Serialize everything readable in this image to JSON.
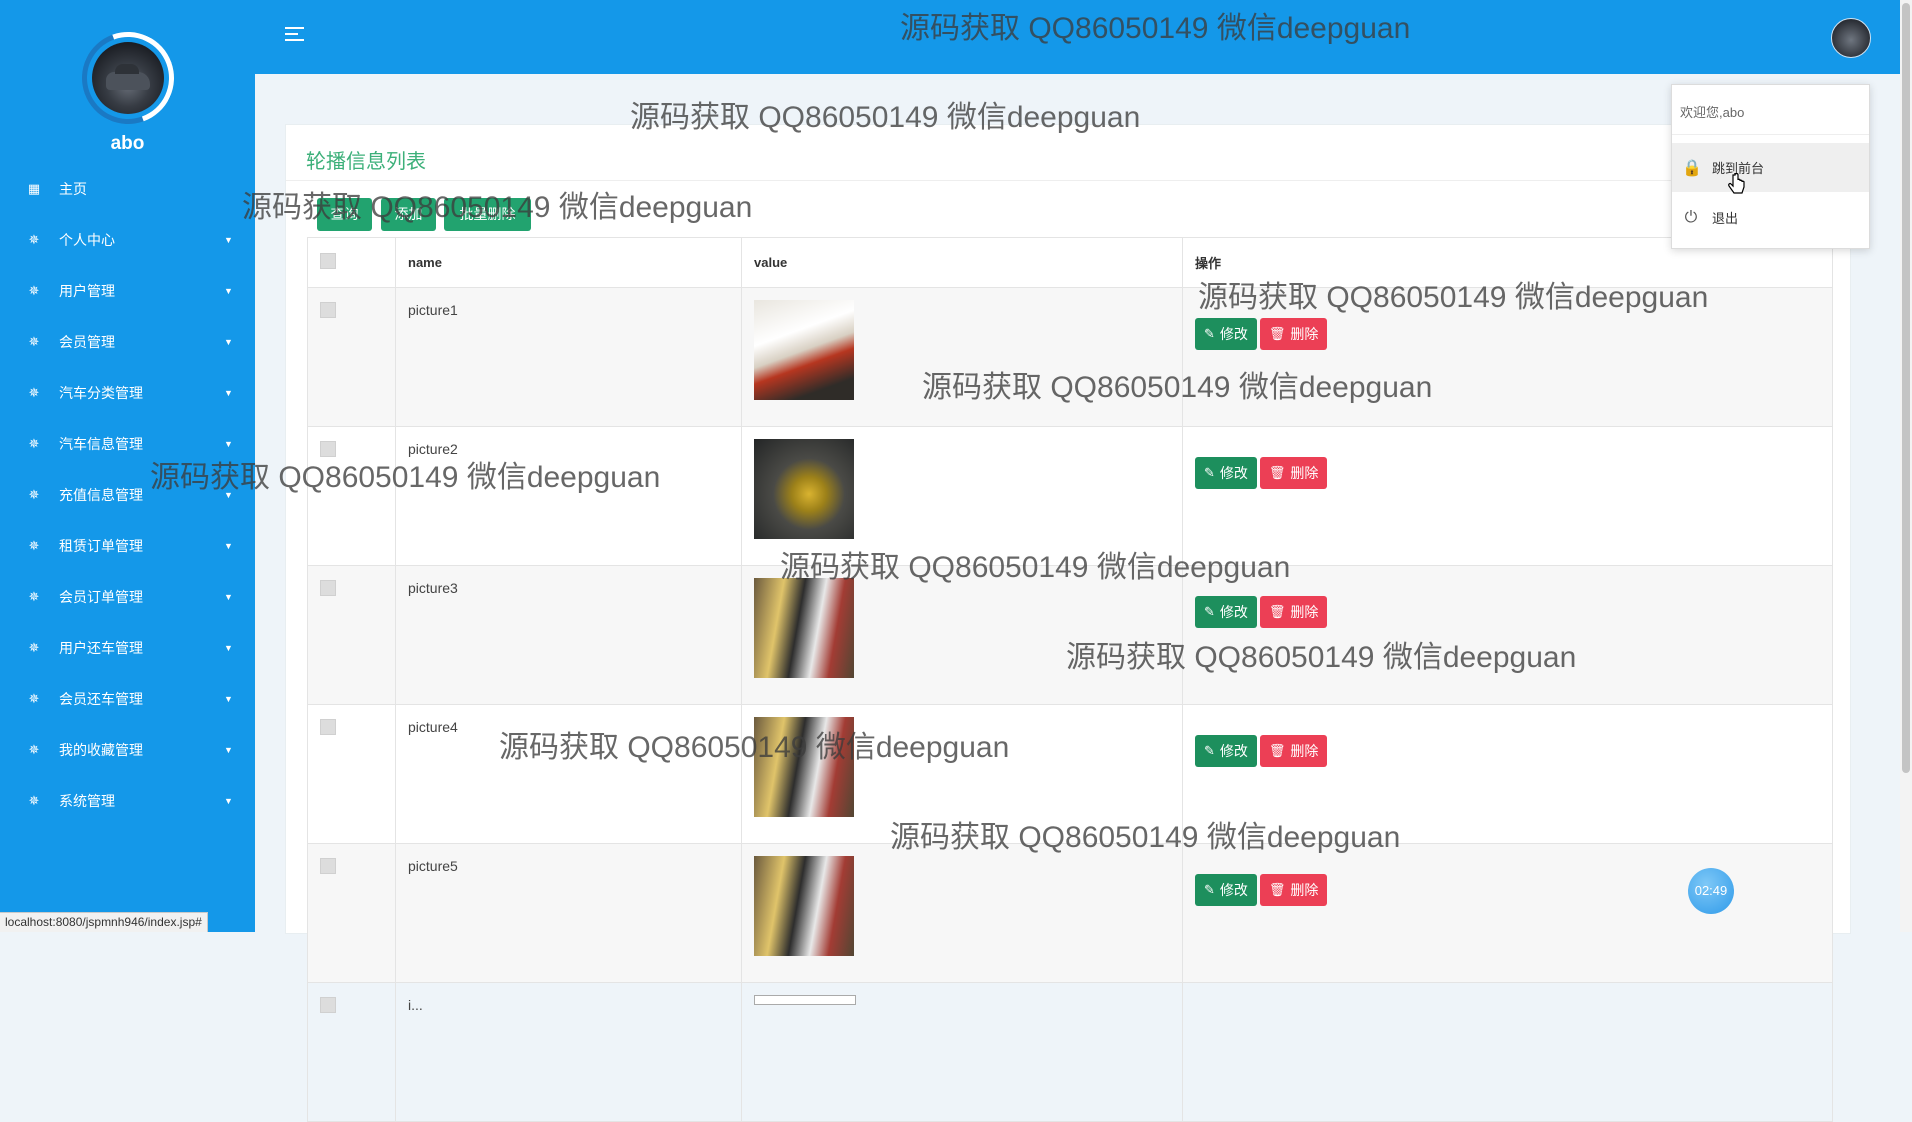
{
  "sidebar": {
    "username": "abo",
    "home": "主页",
    "items": [
      {
        "label": "个人中心"
      },
      {
        "label": "用户管理"
      },
      {
        "label": "会员管理"
      },
      {
        "label": "汽车分类管理"
      },
      {
        "label": "汽车信息管理"
      },
      {
        "label": "充值信息管理"
      },
      {
        "label": "租赁订单管理"
      },
      {
        "label": "会员订单管理"
      },
      {
        "label": "用户还车管理"
      },
      {
        "label": "会员还车管理"
      },
      {
        "label": "我的收藏管理"
      },
      {
        "label": "系统管理"
      }
    ]
  },
  "status_url": "localhost:8080/jspmnh946/index.jsp#",
  "page": {
    "title": "轮播信息列表",
    "buttons": {
      "search": "查询",
      "add": "添加",
      "batch_delete": "批量删除"
    }
  },
  "table": {
    "headers": {
      "name": "name",
      "value": "value",
      "action": "操作"
    },
    "rows": [
      {
        "name": "picture1"
      },
      {
        "name": "picture2"
      },
      {
        "name": "picture3"
      },
      {
        "name": "picture4"
      },
      {
        "name": "picture5"
      },
      {
        "name": "i..."
      }
    ],
    "edit_label": "修改",
    "delete_label": "删除"
  },
  "dropdown": {
    "welcome": "欢迎您,abo",
    "front": "跳到前台",
    "logout": "退出"
  },
  "timer": "02:49",
  "watermark": "源码获取 QQ86050149 微信deepguan"
}
